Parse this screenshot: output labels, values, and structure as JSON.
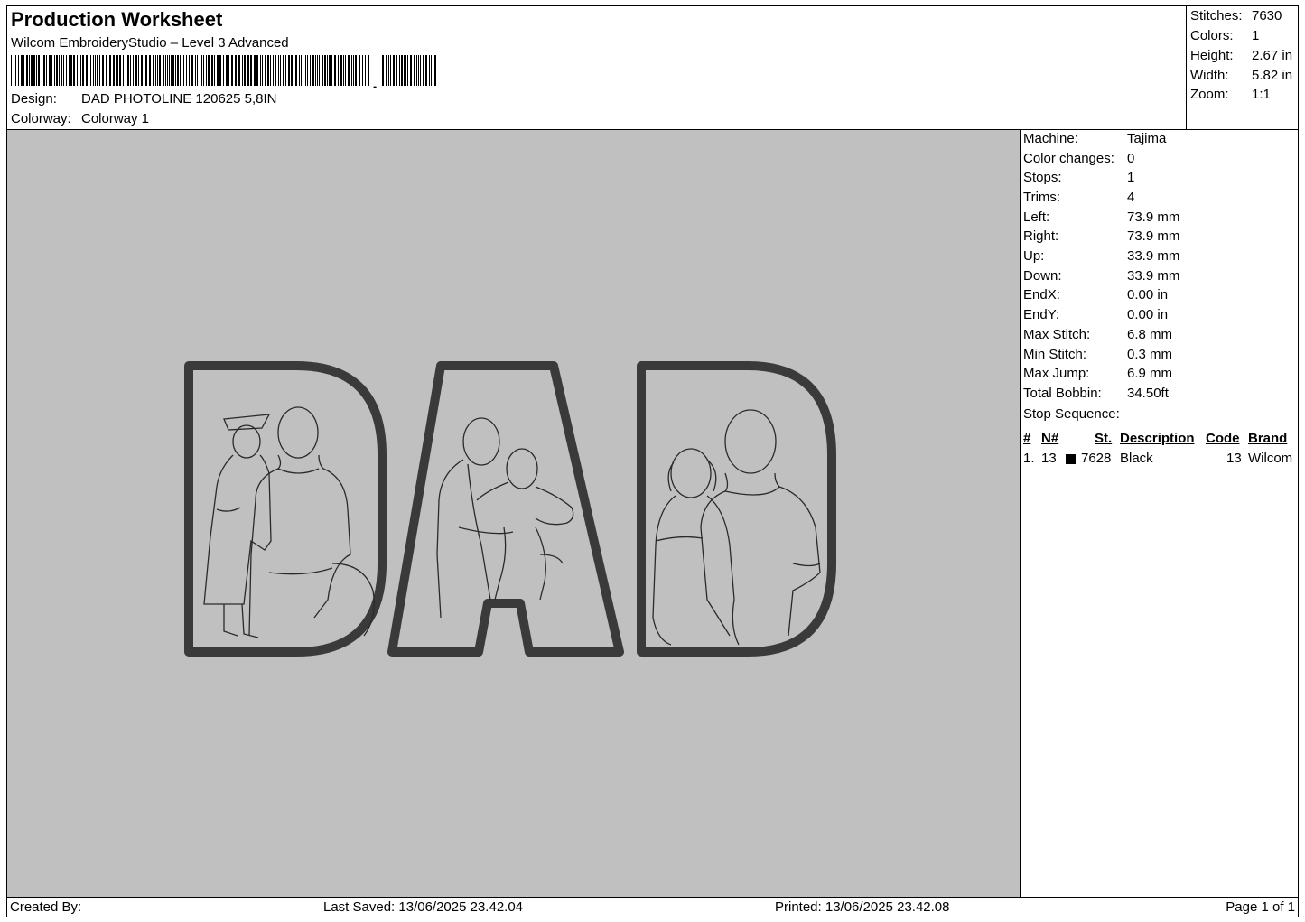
{
  "header": {
    "title": "Production Worksheet",
    "software": "Wilcom EmbroideryStudio – Level 3 Advanced",
    "design_label": "Design:",
    "design_value": "DAD PHOTOLINE 120625 5,8IN",
    "colorway_label": "Colorway:",
    "colorway_value": "Colorway 1"
  },
  "summary": [
    {
      "label": "Stitches:",
      "value": "7630"
    },
    {
      "label": "Colors:",
      "value": "1"
    },
    {
      "label": "Height:",
      "value": "2.67 in"
    },
    {
      "label": "Width:",
      "value": "5.82 in"
    },
    {
      "label": "Zoom:",
      "value": "1:1"
    }
  ],
  "machine_info": [
    {
      "label": "Machine:",
      "value": "Tajima"
    },
    {
      "label": "Color changes:",
      "value": "0"
    },
    {
      "label": "Stops:",
      "value": "1"
    },
    {
      "label": "Trims:",
      "value": "4"
    },
    {
      "label": "Left:",
      "value": "73.9 mm"
    },
    {
      "label": "Right:",
      "value": "73.9 mm"
    },
    {
      "label": "Up:",
      "value": "33.9 mm"
    },
    {
      "label": "Down:",
      "value": "33.9 mm"
    },
    {
      "label": "EndX:",
      "value": "0.00 in"
    },
    {
      "label": "EndY:",
      "value": "0.00 in"
    },
    {
      "label": "Max Stitch:",
      "value": "6.8 mm"
    },
    {
      "label": "Min Stitch:",
      "value": "0.3 mm"
    },
    {
      "label": "Max Jump:",
      "value": "6.9 mm"
    },
    {
      "label": "Total Bobbin:",
      "value": "34.50ft"
    }
  ],
  "stop_sequence": {
    "title": "Stop Sequence:",
    "headers": {
      "num": "#",
      "n": "N#",
      "st": "St.",
      "description": "Description",
      "code": "Code",
      "brand": "Brand"
    },
    "rows": [
      {
        "num": "1.",
        "n": "13",
        "swatch_color": "#000000",
        "st": "7628",
        "description": "Black",
        "code": "13",
        "brand": "Wilcom"
      }
    ]
  },
  "design_preview": {
    "text": "DAD",
    "background": "#c0c0c0",
    "outline_color": "#3a3a3a"
  },
  "footer": {
    "created_by": "Created By:",
    "last_saved": "Last Saved: 13/06/2025 23.42.04",
    "printed": "Printed: 13/06/2025 23.42.08",
    "page": "Page 1 of 1"
  }
}
